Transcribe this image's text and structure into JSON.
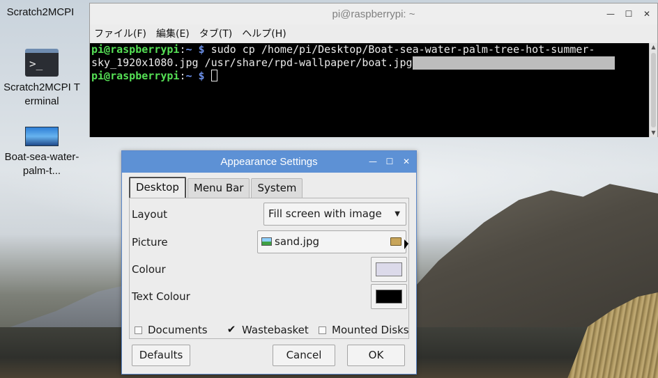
{
  "desktop": {
    "icons": [
      {
        "label": "Scratch2MCPI"
      },
      {
        "label": "Scratch2MCPI Terminal"
      },
      {
        "label": "Boat-sea-water-palm-t..."
      }
    ]
  },
  "terminal": {
    "title": "pi@raspberrypi: ~",
    "menu": [
      "ファイル(F)",
      "編集(E)",
      "タブ(T)",
      "ヘルプ(H)"
    ],
    "lines": [
      {
        "prompt": "pi@raspberrypi",
        "sep": ":",
        "path": "~",
        "symbol": " $ ",
        "text": "sudo cp /home/pi/Desktop/Boat-sea-water-palm-tree-hot-summer-"
      },
      {
        "text": "sky_1920x1080.jpg /usr/share/rpd-wallpaper/boat.jpg"
      },
      {
        "prompt": "pi@raspberrypi",
        "sep": ":",
        "path": "~",
        "symbol": " $ ",
        "text": ""
      }
    ]
  },
  "dialog": {
    "title": "Appearance Settings",
    "tabs": [
      "Desktop",
      "Menu Bar",
      "System"
    ],
    "active_tab": "Desktop",
    "layout": {
      "label": "Layout",
      "value": "Fill screen with image"
    },
    "picture": {
      "label": "Picture",
      "value": "sand.jpg"
    },
    "colour": {
      "label": "Colour",
      "swatch": "#dcdaea"
    },
    "text_colour": {
      "label": "Text Colour",
      "swatch": "#000000"
    },
    "checkboxes": [
      {
        "label": "Documents",
        "checked": false
      },
      {
        "label": "Wastebasket",
        "checked": true
      },
      {
        "label": "Mounted Disks",
        "checked": false
      }
    ],
    "buttons": {
      "defaults": "Defaults",
      "cancel": "Cancel",
      "ok": "OK"
    }
  },
  "colors": {
    "titlebar_accent": "#5d91d5",
    "prompt_green": "#55e055",
    "path_blue": "#6b8fe8"
  }
}
